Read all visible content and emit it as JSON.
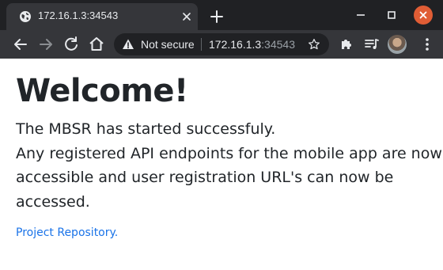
{
  "browser": {
    "tab": {
      "title": "172.16.1.3:34543",
      "favicon": "globe-icon",
      "close_icon": "close-icon"
    },
    "new_tab_icon": "plus-icon",
    "window_controls": [
      "minimize-icon",
      "maximize-icon",
      "close-icon"
    ],
    "toolbar": {
      "back_icon": "arrow-left-icon",
      "forward_icon": "arrow-right-icon",
      "reload_icon": "reload-icon",
      "home_icon": "home-icon",
      "security_label": "Not secure",
      "url_host": "172.16.1.3",
      "url_port": ":34543",
      "bookmark_icon": "star-icon",
      "extensions_icon": "puzzle-icon",
      "media_icon": "playlist-icon",
      "menu_icon": "vertical-dots-icon"
    },
    "colors": {
      "tab_strip": "#202124",
      "toolbar": "#35363a",
      "close_button": "#e05d35",
      "link": "#1a73e8"
    }
  },
  "page": {
    "heading": "Welcome!",
    "paragraph_lines": [
      "The MBSR has started successfuly.",
      "Any registered API endpoints for the mobile app are now",
      "accessible and user registration URL's can now be",
      "accessed."
    ],
    "link_text": "Project Repository."
  }
}
